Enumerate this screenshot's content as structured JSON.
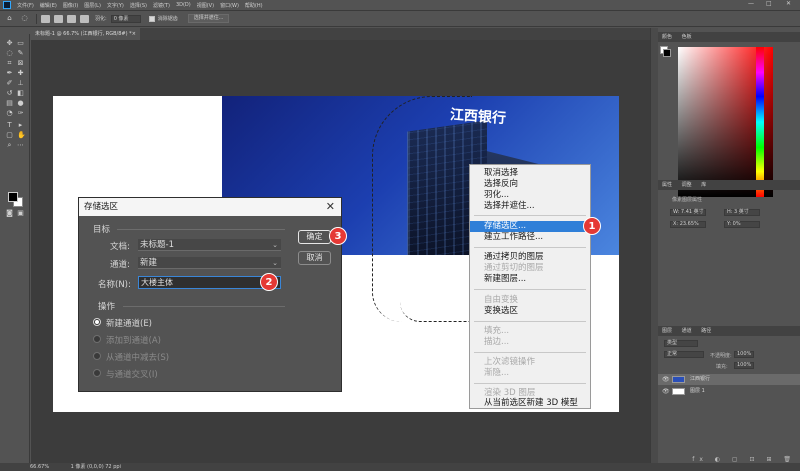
{
  "app": {
    "menu": [
      "文件(F)",
      "编辑(E)",
      "图像(I)",
      "图层(L)",
      "文字(Y)",
      "选择(S)",
      "滤镜(T)",
      "3D(D)",
      "视图(V)",
      "窗口(W)",
      "帮助(H)"
    ],
    "window_controls": {
      "minimize": "—",
      "maximize": "□",
      "close": "✕"
    }
  },
  "options_bar": {
    "feather_label": "羽化:",
    "feather_value": "0 像素",
    "antialias_label": "消除锯齿",
    "select_mask_button": "选择并遮住..."
  },
  "document_tab": {
    "title": "未标题-1 @ 66.7% (江西银行, RGB/8#) *",
    "close": "×"
  },
  "canvas": {
    "building_sign": "江西银行"
  },
  "context_menu": {
    "items": [
      {
        "label": "取消选择",
        "disabled": false
      },
      {
        "label": "选择反向",
        "disabled": false
      },
      {
        "label": "羽化...",
        "disabled": false
      },
      {
        "label": "选择并遮住...",
        "disabled": false
      },
      {
        "label": "存储选区...",
        "disabled": false,
        "highlight": true
      },
      {
        "label": "建立工作路径...",
        "disabled": false
      },
      {
        "label": "通过拷贝的图层",
        "disabled": false
      },
      {
        "label": "通过剪切的图层",
        "disabled": true
      },
      {
        "label": "新建图层...",
        "disabled": false
      },
      {
        "label": "自由变换",
        "disabled": true
      },
      {
        "label": "变换选区",
        "disabled": false
      },
      {
        "label": "填充...",
        "disabled": true
      },
      {
        "label": "描边...",
        "disabled": true
      },
      {
        "label": "上次滤镜操作",
        "disabled": true
      },
      {
        "label": "渐隐...",
        "disabled": true
      },
      {
        "label": "渲染 3D 图层",
        "disabled": true
      },
      {
        "label": "从当前选区新建 3D 模型",
        "disabled": false
      }
    ]
  },
  "dialog": {
    "title": "存储选区",
    "close": "✕",
    "target_group": "目标",
    "document_label": "文档:",
    "document_value": "未标题-1",
    "channel_label": "通道:",
    "channel_value": "新建",
    "name_label": "名称(N):",
    "name_value": "大楼主体",
    "operation_group": "操作",
    "operations": [
      {
        "label": "新建通道(E)",
        "selected": true,
        "disabled": false
      },
      {
        "label": "添加到通道(A)",
        "selected": false,
        "disabled": true
      },
      {
        "label": "从通道中减去(S)",
        "selected": false,
        "disabled": true
      },
      {
        "label": "与通道交叉(I)",
        "selected": false,
        "disabled": true
      }
    ],
    "ok_button": "确定",
    "cancel_button": "取消"
  },
  "steps": {
    "one": "1",
    "two": "2",
    "three": "3"
  },
  "right_panel": {
    "color_tabs": [
      "颜色",
      "色板"
    ],
    "properties_tabs": [
      "属性",
      "调整",
      "库"
    ],
    "properties_title": "像素图层属性",
    "prop_w": "W: 7.41 英寸",
    "prop_h": "H: 3 英寸",
    "prop_x": "X: 23.65%",
    "prop_y": "Y: 0%",
    "layers_tabs": [
      "图层",
      "通道",
      "路径"
    ],
    "layer_kind": "类型",
    "blend_mode": "正常",
    "opacity_label": "不透明度:",
    "opacity_value": "100%",
    "fill_label": "填充:",
    "fill_value": "100%",
    "layers": [
      {
        "name": "江西银行",
        "selected": true
      },
      {
        "name": "图层 1",
        "selected": false
      }
    ],
    "footer_icons": "fx ◐ ▢ ⊡ ⊞ 🗑"
  },
  "status_bar": {
    "zoom": "66.67%",
    "info": "1 像素 (0,0,0) 72 ppi"
  },
  "colors": {
    "ui_bg": "#535353",
    "highlight": "#2f7fd8",
    "badge": "#e53935"
  }
}
